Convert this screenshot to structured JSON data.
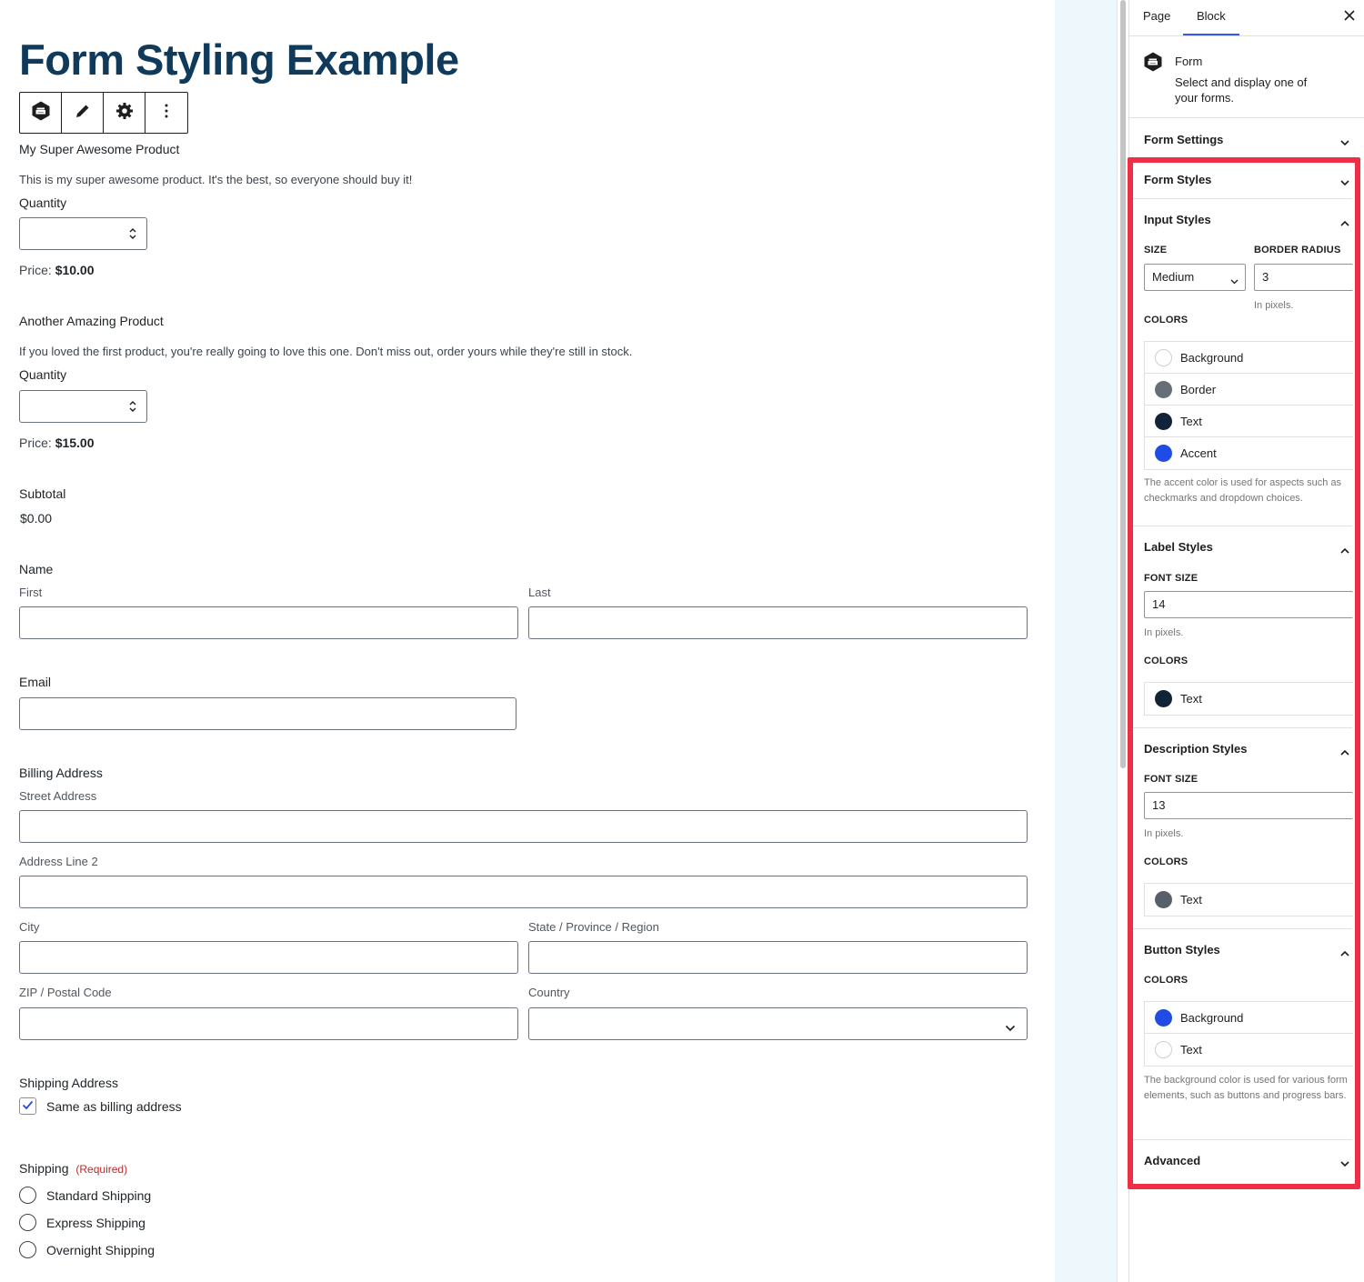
{
  "page": {
    "title": "Form Styling Example"
  },
  "block_toolbar": {
    "icons": [
      "gravity-forms-icon",
      "pencil-icon",
      "gear-icon",
      "more-vertical-icon"
    ]
  },
  "products": [
    {
      "name": "My Super Awesome Product",
      "description": "This is my super awesome product. It's the best, so everyone should buy it!",
      "quantity_label": "Quantity",
      "price_label": "Price:",
      "price_value": "$10.00"
    },
    {
      "name": "Another Amazing Product",
      "description": "If you loved the first product, you're really going to love this one. Don't miss out, order yours while they're still in stock.",
      "quantity_label": "Quantity",
      "price_label": "Price:",
      "price_value": "$15.00"
    }
  ],
  "subtotal": {
    "label": "Subtotal",
    "value": "$0.00"
  },
  "name_field": {
    "label": "Name",
    "first": "First",
    "last": "Last"
  },
  "email_field": {
    "label": "Email"
  },
  "billing": {
    "label": "Billing Address",
    "street": "Street Address",
    "line2": "Address Line 2",
    "city": "City",
    "state": "State / Province / Region",
    "zip": "ZIP / Postal Code",
    "country": "Country"
  },
  "shipping_address": {
    "label": "Shipping Address",
    "same_as_billing": "Same as billing address",
    "checked": true
  },
  "shipping": {
    "label": "Shipping",
    "required": "(Required)",
    "options": [
      "Standard Shipping",
      "Express Shipping",
      "Overnight Shipping"
    ]
  },
  "sidebar": {
    "tabs": {
      "page": "Page",
      "block": "Block",
      "active": "Block"
    },
    "block": {
      "title": "Form",
      "description": "Select and display one of your forms."
    },
    "form_settings": "Form Settings",
    "form_styles": "Form Styles",
    "input_styles": {
      "title": "Input Styles",
      "size_label": "SIZE",
      "size_value": "Medium",
      "radius_label": "BORDER RADIUS",
      "radius_value": "3",
      "radius_help": "In pixels.",
      "colors_label": "COLORS",
      "colors": [
        {
          "name": "Background",
          "color": "#ffffff"
        },
        {
          "name": "Border",
          "color": "#686e77"
        },
        {
          "name": "Text",
          "color": "#112337"
        },
        {
          "name": "Accent",
          "color": "#204ce5"
        }
      ],
      "accent_help": "The accent color is used for aspects such as checkmarks and dropdown choices."
    },
    "label_styles": {
      "title": "Label Styles",
      "font_size_label": "FONT SIZE",
      "font_size_value": "14",
      "font_size_help": "In pixels.",
      "colors_label": "COLORS",
      "colors": [
        {
          "name": "Text",
          "color": "#112337"
        }
      ]
    },
    "description_styles": {
      "title": "Description Styles",
      "font_size_label": "FONT SIZE",
      "font_size_value": "13",
      "font_size_help": "In pixels.",
      "colors_label": "COLORS",
      "colors": [
        {
          "name": "Text",
          "color": "#585e6a"
        }
      ]
    },
    "button_styles": {
      "title": "Button Styles",
      "colors_label": "COLORS",
      "colors": [
        {
          "name": "Background",
          "color": "#204ce5"
        },
        {
          "name": "Text",
          "color": "#ffffff"
        }
      ],
      "help": "The background color is used for various form elements, such as buttons and progress bars."
    },
    "advanced": "Advanced"
  },
  "colors": {
    "title": "#0f3a5b",
    "highlight": "#ef2f45",
    "tab_accent": "#3858e9",
    "gutter": "#eef7fc"
  }
}
